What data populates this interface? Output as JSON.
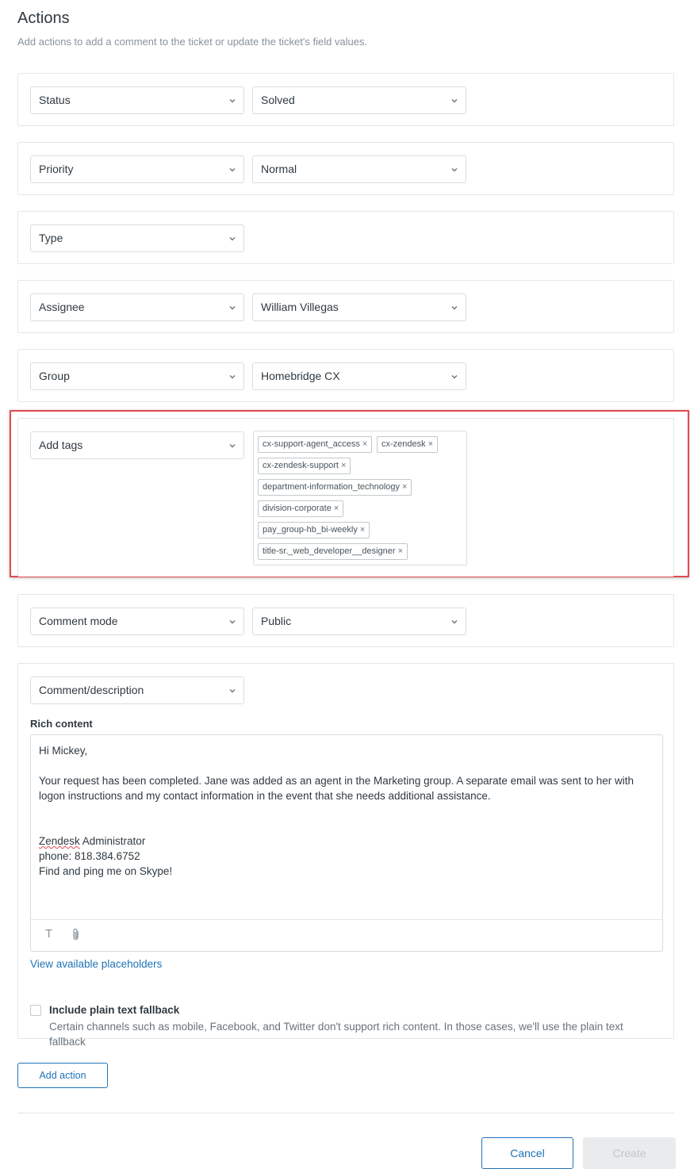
{
  "header": {
    "title": "Actions",
    "subtitle": "Add actions to add a comment to the ticket or update the ticket's field values."
  },
  "actions": [
    {
      "field": "Status",
      "value": "Solved"
    },
    {
      "field": "Priority",
      "value": "Normal"
    },
    {
      "field": "Type"
    },
    {
      "field": "Assignee",
      "value": "William Villegas"
    },
    {
      "field": "Group",
      "value": "Homebridge CX"
    }
  ],
  "tags_action": {
    "field": "Add tags",
    "tags": [
      "cx-support-agent_access",
      "cx-zendesk",
      "cx-zendesk-support",
      "department-information_technology",
      "division-corporate",
      "pay_group-hb_bi-weekly",
      "title-sr._web_developer__designer"
    ],
    "remove_glyph": "×"
  },
  "comment_mode": {
    "field": "Comment mode",
    "value": "Public"
  },
  "comment": {
    "field": "Comment/description",
    "rich_label": "Rich content",
    "lines": [
      "Hi Mickey,",
      "Your request has been completed. Jane was added as an agent in the Marketing group. A separate email was sent to her with",
      "logon instructions and my contact information in the event that she needs additional assistance.",
      "Zendesk",
      " Administrator",
      "phone: 818.384.6752",
      "Find and ping me on Skype!"
    ],
    "toolbar": {
      "text_icon": "T"
    },
    "placeholders_link": "View available placeholders",
    "fallback": {
      "label": "Include plain text fallback",
      "hint": "Certain channels such as mobile, Facebook, and Twitter don't support rich content. In those cases, we'll use the plain text fallback",
      "checked": false
    }
  },
  "footer": {
    "add_action": "Add action",
    "cancel": "Cancel",
    "create": "Create"
  },
  "colors": {
    "accent": "#1f73b7",
    "highlight_border": "#e14a4f",
    "disabled_button": "#e9ebed"
  },
  "icons": {
    "dropdown": "chevron-down-icon",
    "tag_remove": "close-icon",
    "toolbar_text": "text-format-icon",
    "toolbar_attach": "paperclip-icon"
  }
}
